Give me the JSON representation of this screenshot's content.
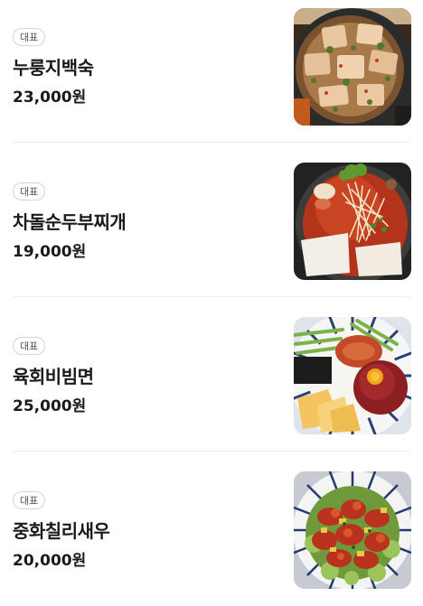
{
  "menu": {
    "items": [
      {
        "badge": "대표",
        "name": "누룽지백숙",
        "price": "23,000원",
        "image": "nurungji-baeksuk-photo"
      },
      {
        "badge": "대표",
        "name": "차돌순두부찌개",
        "price": "19,000원",
        "image": "chadol-sundubu-jjigae-photo"
      },
      {
        "badge": "대표",
        "name": "육회비빔면",
        "price": "25,000원",
        "image": "yukhoe-bibimmyeon-photo"
      },
      {
        "badge": "대표",
        "name": "중화칠리새우",
        "price": "20,000원",
        "image": "chili-shrimp-photo"
      }
    ]
  }
}
